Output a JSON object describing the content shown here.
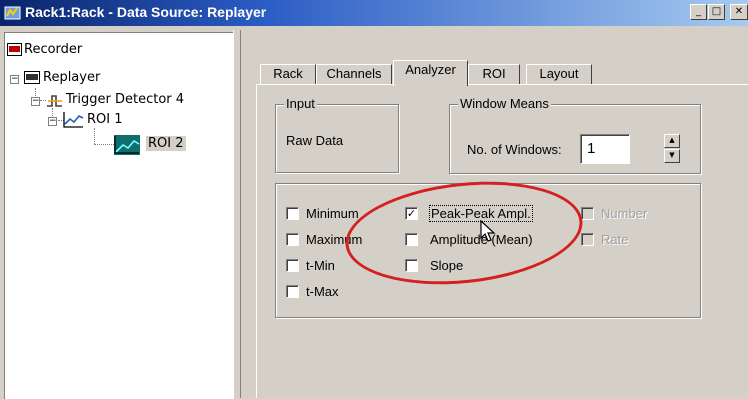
{
  "window": {
    "title": "Rack1:Rack - Data Source: Replayer",
    "minimize_label": "_",
    "maximize_label": "□",
    "close_label": "✕",
    "title_color": "#0a246a"
  },
  "tree": {
    "items": [
      {
        "label": "Recorder",
        "icon": "recorder-icon"
      },
      {
        "label": "Replayer",
        "icon": "replayer-icon",
        "expander": "−"
      },
      {
        "label": "Trigger Detector 4",
        "icon": "trigger-icon",
        "expander": "−"
      },
      {
        "label": "ROI 1",
        "icon": "chart-icon",
        "expander": "−"
      },
      {
        "label": "ROI 2",
        "icon": "chart-icon",
        "selected": true
      }
    ]
  },
  "tabs": [
    {
      "label": "Rack"
    },
    {
      "label": "Channels"
    },
    {
      "label": "Analyzer",
      "active": true
    },
    {
      "label": "ROI"
    },
    {
      "label": "Layout"
    }
  ],
  "input_group": {
    "title": "Input",
    "value": "Raw Data"
  },
  "window_means": {
    "title": "Window Means",
    "label": "No. of Windows:",
    "value": "1",
    "up": "▲",
    "down": "▼"
  },
  "checks": {
    "minimum": {
      "label": "Minimum",
      "checked": false
    },
    "maximum": {
      "label": "Maximum",
      "checked": false
    },
    "tmin": {
      "label": "t-Min",
      "checked": false
    },
    "tmax": {
      "label": "t-Max",
      "checked": false
    },
    "peak": {
      "label": "Peak-Peak Ampl.",
      "checked": true,
      "mark": "✓"
    },
    "amplitude": {
      "label": "Amplitude (Mean)",
      "checked": false
    },
    "slope": {
      "label": "Slope",
      "checked": false
    },
    "number": {
      "label": "Number",
      "checked": false,
      "disabled": true
    },
    "rate": {
      "label": "Rate",
      "checked": false,
      "disabled": true
    }
  },
  "annotation": {
    "color": "#d42020",
    "shape": "ellipse"
  }
}
